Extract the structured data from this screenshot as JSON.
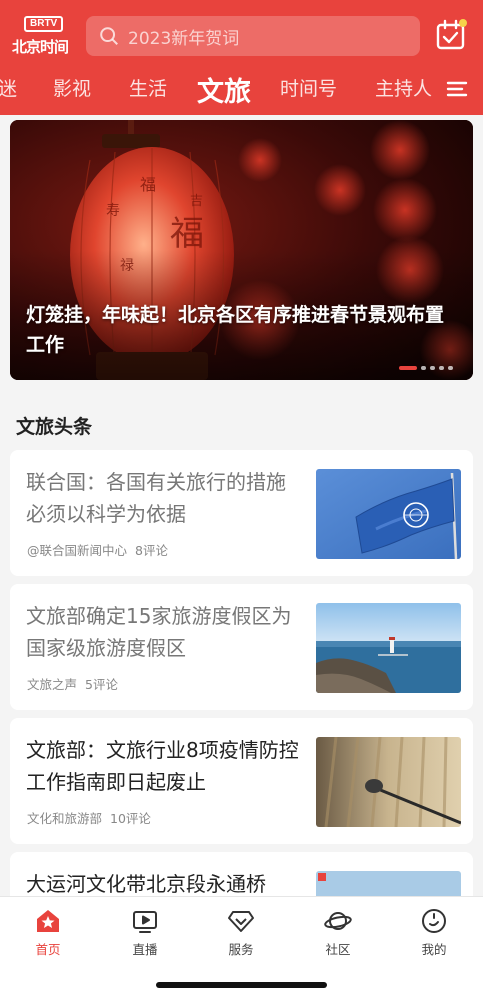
{
  "header": {
    "logo_badge": "BRTV",
    "logo_text": "北京时间",
    "search_placeholder": "2023新年贺词"
  },
  "tabs": [
    {
      "label": "迷",
      "active": false
    },
    {
      "label": "影视",
      "active": false
    },
    {
      "label": "生活",
      "active": false
    },
    {
      "label": "文旅",
      "active": true
    },
    {
      "label": "时间号",
      "active": false
    },
    {
      "label": "主持人",
      "active": false
    }
  ],
  "hero": {
    "title": "灯笼挂，年味起！北京各区有序推进春节景观布置工作",
    "slide_count": 5,
    "active_slide": 1
  },
  "section": {
    "title": "文旅头条"
  },
  "news": [
    {
      "title": "联合国：各国有关旅行的措施必须以科学为依据",
      "source": "@联合国新闻中心",
      "comments": "8评论",
      "read": true
    },
    {
      "title": "文旅部确定15家旅游度假区为国家级旅游度假区",
      "source": "文旅之声",
      "comments": "5评论",
      "read": true
    },
    {
      "title": "文旅部：文旅行业8项疫情防控工作指南即日起废止",
      "source": "文化和旅游部",
      "comments": "10评论",
      "read": false
    },
    {
      "title": "大运河文化带北京段永通桥",
      "source": "",
      "comments": "",
      "read": false
    }
  ],
  "bottom_nav": [
    {
      "label": "首页",
      "icon": "home-star-icon",
      "active": true
    },
    {
      "label": "直播",
      "icon": "live-tv-icon",
      "active": false
    },
    {
      "label": "服务",
      "icon": "diamond-icon",
      "active": false
    },
    {
      "label": "社区",
      "icon": "planet-icon",
      "active": false
    },
    {
      "label": "我的",
      "icon": "profile-icon",
      "active": false
    }
  ],
  "colors": {
    "brand_red": "#e8433d",
    "notification_dot": "#f6d34a",
    "un_blue": "#2f66c2"
  }
}
